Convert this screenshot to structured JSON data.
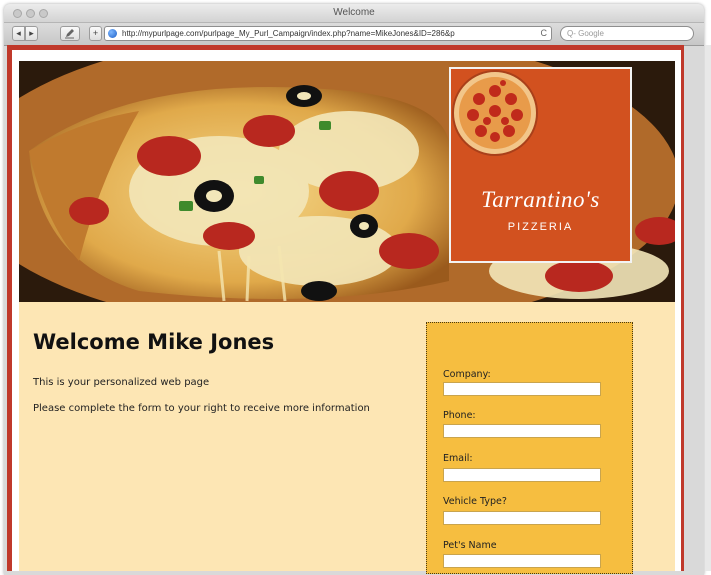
{
  "window": {
    "title": "Welcome",
    "url": "http://mypurlpage.com/purlpage_My_Purl_Campaign/index.php?name=MikeJones&ID=286&p",
    "search_placeholder": "Q- Google",
    "reload_glyph": "C",
    "back_glyph": "◂",
    "forward_glyph": "▸",
    "add_glyph": "+"
  },
  "banner": {
    "brand_name": "Tarrantino's",
    "brand_sub": "PIZZERIA"
  },
  "content": {
    "heading": "Welcome Mike Jones",
    "line1": "This is your personalized web page",
    "line2": "Please complete the form to your right to receive more information"
  },
  "form": {
    "fields": [
      {
        "label": "Company:"
      },
      {
        "label": "Phone:"
      },
      {
        "label": "Email:"
      },
      {
        "label": "Vehicle Type?"
      },
      {
        "label": "Pet's Name"
      }
    ]
  },
  "colors": {
    "frame_red": "#c0392b",
    "logo_orange": "#d2511f",
    "content_bg": "#fde6b4",
    "form_bg": "#f6be40"
  }
}
